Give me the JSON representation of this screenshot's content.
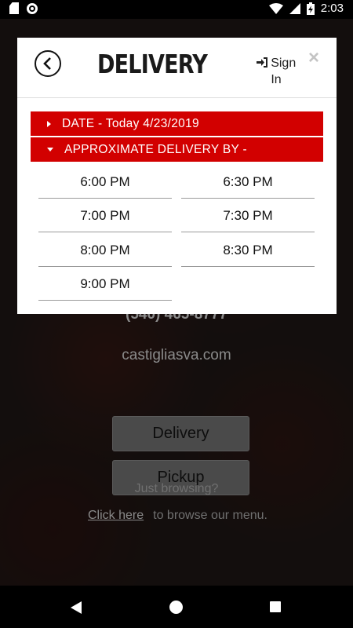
{
  "status_bar": {
    "time": "2:03",
    "icons": [
      "sd-card-icon",
      "sync-circle-icon",
      "wifi-icon",
      "signal-icon",
      "battery-charging-icon"
    ]
  },
  "background": {
    "phone": "(540) 465-8777",
    "website": "castigliasva.com",
    "delivery_button": "Delivery",
    "pickup_button": "Pickup",
    "just_browsing": "Just browsing?",
    "click_here": "Click here",
    "browse_text": "to browse our menu."
  },
  "modal": {
    "title": "DELIVERY",
    "sign_in": "Sign In",
    "close": "×",
    "date_bar": "DATE - Today 4/23/2019",
    "delivery_by_bar": "APPROXIMATE DELIVERY BY -",
    "time_slots": [
      "6:00 PM",
      "6:30 PM",
      "7:00 PM",
      "7:30 PM",
      "8:00 PM",
      "8:30 PM",
      "9:00 PM"
    ]
  },
  "colors": {
    "accent_red": "#d20000",
    "background_dark": "#1a1414"
  }
}
